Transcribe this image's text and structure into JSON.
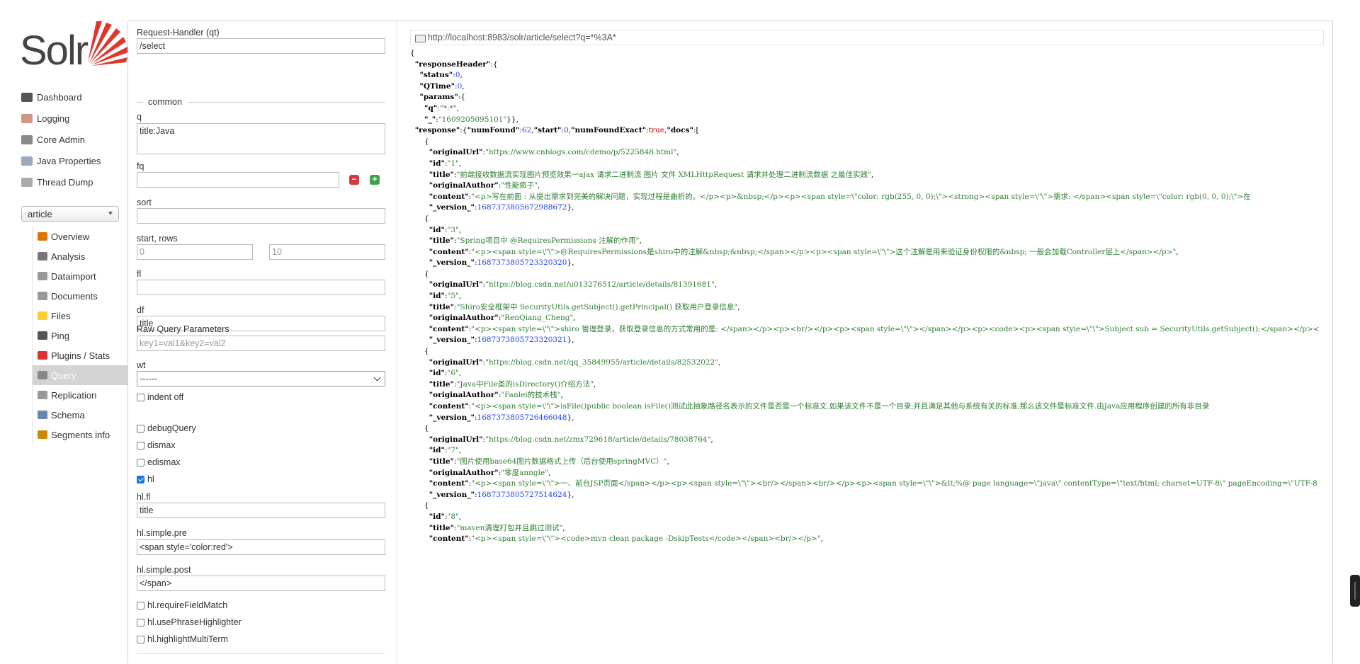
{
  "app": {
    "logo_text": "Solr"
  },
  "nav": {
    "items": [
      {
        "label": "Dashboard",
        "icon": "dashboard-icon",
        "color": "#555"
      },
      {
        "label": "Logging",
        "icon": "logging-icon",
        "color": "#c98"
      },
      {
        "label": "Core Admin",
        "icon": "core-admin-icon",
        "color": "#888"
      },
      {
        "label": "Java Properties",
        "icon": "java-properties-icon",
        "color": "#9ab"
      },
      {
        "label": "Thread Dump",
        "icon": "thread-dump-icon",
        "color": "#aaa"
      }
    ],
    "core_selected": "article",
    "core_items": [
      {
        "label": "Overview",
        "icon": "overview-icon",
        "color": "#d70"
      },
      {
        "label": "Analysis",
        "icon": "analysis-icon",
        "color": "#777"
      },
      {
        "label": "Dataimport",
        "icon": "dataimport-icon",
        "color": "#999"
      },
      {
        "label": "Documents",
        "icon": "documents-icon",
        "color": "#999"
      },
      {
        "label": "Files",
        "icon": "files-icon",
        "color": "#fc3"
      },
      {
        "label": "Ping",
        "icon": "ping-icon",
        "color": "#555"
      },
      {
        "label": "Plugins / Stats",
        "icon": "plugins-icon",
        "color": "#d33"
      },
      {
        "label": "Query",
        "icon": "query-icon",
        "color": "#888",
        "active": true
      },
      {
        "label": "Replication",
        "icon": "replication-icon",
        "color": "#999"
      },
      {
        "label": "Schema",
        "icon": "schema-icon",
        "color": "#68a"
      },
      {
        "label": "Segments info",
        "icon": "segments-icon",
        "color": "#c80"
      }
    ]
  },
  "form": {
    "qt_label": "Request-Handler (qt)",
    "qt_value": "/select",
    "common_legend": "common",
    "q_label": "q",
    "q_value": "title:Java",
    "fq_label": "fq",
    "fq_value": "",
    "fq_remove": "−",
    "fq_add": "+",
    "sort_label": "sort",
    "sort_value": "",
    "start_rows_label": "start, rows",
    "start_placeholder": "0",
    "rows_placeholder": "10",
    "fl_label": "fl",
    "fl_value": "",
    "df_label": "df",
    "df_value": "title",
    "raw_label": "Raw Query Parameters",
    "raw_placeholder": "key1=val1&key2=val2",
    "wt_label": "wt",
    "wt_value": "------",
    "indent_label": "indent off",
    "debug_label": "debugQuery",
    "dismax_label": "dismax",
    "edismax_label": "edismax",
    "hl_label": "hl",
    "hl_checked": true,
    "hlfl_label": "hl.fl",
    "hlfl_value": "title",
    "pre_label": "hl.simple.pre",
    "pre_value": "<span style='color:red'>",
    "post_label": "hl.simple.post",
    "post_value": "</span>",
    "rfm_label": "hl.requireFieldMatch",
    "uph_label": "hl.usePhraseHighlighter",
    "hmt_label": "hl.highlightMultiTerm"
  },
  "response": {
    "url": "http://localhost:8983/solr/article/select?q=*%3A*",
    "lines": [
      [
        {
          "t": "p",
          "v": "{"
        }
      ],
      [
        {
          "t": "p",
          "v": "  "
        },
        {
          "t": "k",
          "v": "\"responseHeader\""
        },
        {
          "t": "p",
          "v": ":{"
        }
      ],
      [
        {
          "t": "p",
          "v": "    "
        },
        {
          "t": "k",
          "v": "\"status\""
        },
        {
          "t": "p",
          "v": ":"
        },
        {
          "t": "n",
          "v": "0"
        },
        {
          "t": "p",
          "v": ","
        }
      ],
      [
        {
          "t": "p",
          "v": "    "
        },
        {
          "t": "k",
          "v": "\"QTime\""
        },
        {
          "t": "p",
          "v": ":"
        },
        {
          "t": "n",
          "v": "0"
        },
        {
          "t": "p",
          "v": ","
        }
      ],
      [
        {
          "t": "p",
          "v": "    "
        },
        {
          "t": "k",
          "v": "\"params\""
        },
        {
          "t": "p",
          "v": ":{"
        }
      ],
      [
        {
          "t": "p",
          "v": "      "
        },
        {
          "t": "k",
          "v": "\"q\""
        },
        {
          "t": "p",
          "v": ":"
        },
        {
          "t": "s",
          "v": "\"*:*\""
        },
        {
          "t": "p",
          "v": ","
        }
      ],
      [
        {
          "t": "p",
          "v": "      "
        },
        {
          "t": "k",
          "v": "\"_\""
        },
        {
          "t": "p",
          "v": ":"
        },
        {
          "t": "s",
          "v": "\"1609205095101\""
        },
        {
          "t": "p",
          "v": "}},"
        }
      ],
      [
        {
          "t": "p",
          "v": "  "
        },
        {
          "t": "k",
          "v": "\"response\""
        },
        {
          "t": "p",
          "v": ":{"
        },
        {
          "t": "k",
          "v": "\"numFound\""
        },
        {
          "t": "p",
          "v": ":"
        },
        {
          "t": "n",
          "v": "62"
        },
        {
          "t": "p",
          "v": ","
        },
        {
          "t": "k",
          "v": "\"start\""
        },
        {
          "t": "p",
          "v": ":"
        },
        {
          "t": "n",
          "v": "0"
        },
        {
          "t": "p",
          "v": ","
        },
        {
          "t": "k",
          "v": "\"numFoundExact\""
        },
        {
          "t": "p",
          "v": ":"
        },
        {
          "t": "b",
          "v": "true"
        },
        {
          "t": "p",
          "v": ","
        },
        {
          "t": "k",
          "v": "\"docs\""
        },
        {
          "t": "p",
          "v": ":["
        }
      ],
      [
        {
          "t": "p",
          "v": "      {"
        }
      ],
      [
        {
          "t": "p",
          "v": "        "
        },
        {
          "t": "k",
          "v": "\"originalUrl\""
        },
        {
          "t": "p",
          "v": ":"
        },
        {
          "t": "s",
          "v": "\"https://www.cnblogs.com/cdemo/p/5225848.html\""
        },
        {
          "t": "p",
          "v": ","
        }
      ],
      [
        {
          "t": "p",
          "v": "        "
        },
        {
          "t": "k",
          "v": "\"id\""
        },
        {
          "t": "p",
          "v": ":"
        },
        {
          "t": "s",
          "v": "\"1\""
        },
        {
          "t": "p",
          "v": ","
        }
      ],
      [
        {
          "t": "p",
          "v": "        "
        },
        {
          "t": "k",
          "v": "\"title\""
        },
        {
          "t": "p",
          "v": ":"
        },
        {
          "t": "s",
          "v": "\"前端接收数据流实现图片预览效果一ajax 请求二进制流 图片 文件 XMLHttpRequest 请求并处理二进制流数据 之最佳实践\""
        },
        {
          "t": "p",
          "v": ","
        }
      ],
      [
        {
          "t": "p",
          "v": "        "
        },
        {
          "t": "k",
          "v": "\"originalAuthor\""
        },
        {
          "t": "p",
          "v": ":"
        },
        {
          "t": "s",
          "v": "\"性能疯子\""
        },
        {
          "t": "p",
          "v": ","
        }
      ],
      [
        {
          "t": "p",
          "v": "        "
        },
        {
          "t": "k",
          "v": "\"content\""
        },
        {
          "t": "p",
          "v": ":"
        },
        {
          "t": "s",
          "v": "\"<p>写在前面 : 从提出需求到完美的解决问题，实现过程是曲折的。</p><p>&nbsp;</p><p><span style=\\\"color: rgb(255, 0, 0);\\\"><strong><span style=\\\"\\\">需求: </span><span style=\\\"color: rgb(0, 0, 0);\\\">在"
        }
      ],
      [
        {
          "t": "p",
          "v": "        "
        },
        {
          "t": "k",
          "v": "\"_version_\""
        },
        {
          "t": "p",
          "v": ":"
        },
        {
          "t": "n",
          "v": "1687373805672988672"
        },
        {
          "t": "p",
          "v": "},"
        }
      ],
      [
        {
          "t": "p",
          "v": "      {"
        }
      ],
      [
        {
          "t": "p",
          "v": "        "
        },
        {
          "t": "k",
          "v": "\"id\""
        },
        {
          "t": "p",
          "v": ":"
        },
        {
          "t": "s",
          "v": "\"3\""
        },
        {
          "t": "p",
          "v": ","
        }
      ],
      [
        {
          "t": "p",
          "v": "        "
        },
        {
          "t": "k",
          "v": "\"title\""
        },
        {
          "t": "p",
          "v": ":"
        },
        {
          "t": "s",
          "v": "\"Spring项目中 @RequiresPermissions 注解的作用\""
        },
        {
          "t": "p",
          "v": ","
        }
      ],
      [
        {
          "t": "p",
          "v": "        "
        },
        {
          "t": "k",
          "v": "\"content\""
        },
        {
          "t": "p",
          "v": ":"
        },
        {
          "t": "s",
          "v": "\"<p><span style=\\\"\\\">@RequiresPermissions是shiro中的注解&nbsp;&nbsp;</span></p><p><span style=\\\"\\\">这个注解是用来验证身份权限的&nbsp; 一般会加载Controller层上</span></p>\""
        },
        {
          "t": "p",
          "v": ","
        }
      ],
      [
        {
          "t": "p",
          "v": "        "
        },
        {
          "t": "k",
          "v": "\"_version_\""
        },
        {
          "t": "p",
          "v": ":"
        },
        {
          "t": "n",
          "v": "1687373805723320320"
        },
        {
          "t": "p",
          "v": "},"
        }
      ],
      [
        {
          "t": "p",
          "v": "      {"
        }
      ],
      [
        {
          "t": "p",
          "v": "        "
        },
        {
          "t": "k",
          "v": "\"originalUrl\""
        },
        {
          "t": "p",
          "v": ":"
        },
        {
          "t": "s",
          "v": "\"https://blog.csdn.net/u013276512/article/details/81391681\""
        },
        {
          "t": "p",
          "v": ","
        }
      ],
      [
        {
          "t": "p",
          "v": "        "
        },
        {
          "t": "k",
          "v": "\"id\""
        },
        {
          "t": "p",
          "v": ":"
        },
        {
          "t": "s",
          "v": "\"5\""
        },
        {
          "t": "p",
          "v": ","
        }
      ],
      [
        {
          "t": "p",
          "v": "        "
        },
        {
          "t": "k",
          "v": "\"title\""
        },
        {
          "t": "p",
          "v": ":"
        },
        {
          "t": "s",
          "v": "\"Shiro安全框架中 SecurityUtils.getSubject().getPrincipal() 获取用户登录信息\""
        },
        {
          "t": "p",
          "v": ","
        }
      ],
      [
        {
          "t": "p",
          "v": "        "
        },
        {
          "t": "k",
          "v": "\"originalAuthor\""
        },
        {
          "t": "p",
          "v": ":"
        },
        {
          "t": "s",
          "v": "\"RenQiang_Cheng\""
        },
        {
          "t": "p",
          "v": ","
        }
      ],
      [
        {
          "t": "p",
          "v": "        "
        },
        {
          "t": "k",
          "v": "\"content\""
        },
        {
          "t": "p",
          "v": ":"
        },
        {
          "t": "s",
          "v": "\"<p><span style=\\\"\\\">shiro 管理登录，获取登录信息的方式常用的是: </span></p><p><br/></p><p><span style=\\\"\\\"></span></p><p><code><p><span style=\\\"\\\">Subject sub = SecurityUtils.getSubject();</span></p><"
        }
      ],
      [
        {
          "t": "p",
          "v": "        "
        },
        {
          "t": "k",
          "v": "\"_version_\""
        },
        {
          "t": "p",
          "v": ":"
        },
        {
          "t": "n",
          "v": "1687373805723320321"
        },
        {
          "t": "p",
          "v": "},"
        }
      ],
      [
        {
          "t": "p",
          "v": "      {"
        }
      ],
      [
        {
          "t": "p",
          "v": "        "
        },
        {
          "t": "k",
          "v": "\"originalUrl\""
        },
        {
          "t": "p",
          "v": ":"
        },
        {
          "t": "s",
          "v": "\"https://blog.csdn.net/qq_35849955/article/details/82532022\""
        },
        {
          "t": "p",
          "v": ","
        }
      ],
      [
        {
          "t": "p",
          "v": "        "
        },
        {
          "t": "k",
          "v": "\"id\""
        },
        {
          "t": "p",
          "v": ":"
        },
        {
          "t": "s",
          "v": "\"6\""
        },
        {
          "t": "p",
          "v": ","
        }
      ],
      [
        {
          "t": "p",
          "v": "        "
        },
        {
          "t": "k",
          "v": "\"title\""
        },
        {
          "t": "p",
          "v": ":"
        },
        {
          "t": "s",
          "v": "\"Java中File类的isDirectory()介绍方法\""
        },
        {
          "t": "p",
          "v": ","
        }
      ],
      [
        {
          "t": "p",
          "v": "        "
        },
        {
          "t": "k",
          "v": "\"originalAuthor\""
        },
        {
          "t": "p",
          "v": ":"
        },
        {
          "t": "s",
          "v": "\"Fanlei的技术栈\""
        },
        {
          "t": "p",
          "v": ","
        }
      ],
      [
        {
          "t": "p",
          "v": "        "
        },
        {
          "t": "k",
          "v": "\"content\""
        },
        {
          "t": "p",
          "v": ":"
        },
        {
          "t": "s",
          "v": "\"<p><span style=\\\"\\\">isFile()public boolean isFile()测试此抽象路径名表示的文件是否是一个标准文.如果该文件不是一个目录,并且满足其他与系统有关的标准,那么该文件是标准文件.由Java应用程序创建的所有非目录"
        }
      ],
      [
        {
          "t": "p",
          "v": "        "
        },
        {
          "t": "k",
          "v": "\"_version_\""
        },
        {
          "t": "p",
          "v": ":"
        },
        {
          "t": "n",
          "v": "1687373805726466048"
        },
        {
          "t": "p",
          "v": "},"
        }
      ],
      [
        {
          "t": "p",
          "v": "      {"
        }
      ],
      [
        {
          "t": "p",
          "v": "        "
        },
        {
          "t": "k",
          "v": "\"originalUrl\""
        },
        {
          "t": "p",
          "v": ":"
        },
        {
          "t": "s",
          "v": "\"https://blog.csdn.net/zmx729618/article/details/78038764\""
        },
        {
          "t": "p",
          "v": ","
        }
      ],
      [
        {
          "t": "p",
          "v": "        "
        },
        {
          "t": "k",
          "v": "\"id\""
        },
        {
          "t": "p",
          "v": ":"
        },
        {
          "t": "s",
          "v": "\"7\""
        },
        {
          "t": "p",
          "v": ","
        }
      ],
      [
        {
          "t": "p",
          "v": "        "
        },
        {
          "t": "k",
          "v": "\"title\""
        },
        {
          "t": "p",
          "v": ":"
        },
        {
          "t": "s",
          "v": "\"图片使用base64图片数据格式上传（后台使用springMVC）\""
        },
        {
          "t": "p",
          "v": ","
        }
      ],
      [
        {
          "t": "p",
          "v": "        "
        },
        {
          "t": "k",
          "v": "\"originalAuthor\""
        },
        {
          "t": "p",
          "v": ":"
        },
        {
          "t": "s",
          "v": "\"零度anngle\""
        },
        {
          "t": "p",
          "v": ","
        }
      ],
      [
        {
          "t": "p",
          "v": "        "
        },
        {
          "t": "k",
          "v": "\"content\""
        },
        {
          "t": "p",
          "v": ":"
        },
        {
          "t": "s",
          "v": "\"<p><span style=\\\"\\\">一、前台JSP页面</span></p><p><span style=\\\"\\\"><br/></span><br/></p><p><span style=\\\"\\\">&lt;%@ page language=\\\"java\\\" contentType=\\\"text/html; charset=UTF-8\\\" pageEncoding=\\\"UTF-8"
        }
      ],
      [
        {
          "t": "p",
          "v": "        "
        },
        {
          "t": "k",
          "v": "\"_version_\""
        },
        {
          "t": "p",
          "v": ":"
        },
        {
          "t": "n",
          "v": "1687373805727514624"
        },
        {
          "t": "p",
          "v": "},"
        }
      ],
      [
        {
          "t": "p",
          "v": "      {"
        }
      ],
      [
        {
          "t": "p",
          "v": "        "
        },
        {
          "t": "k",
          "v": "\"id\""
        },
        {
          "t": "p",
          "v": ":"
        },
        {
          "t": "s",
          "v": "\"8\""
        },
        {
          "t": "p",
          "v": ","
        }
      ],
      [
        {
          "t": "p",
          "v": "        "
        },
        {
          "t": "k",
          "v": "\"title\""
        },
        {
          "t": "p",
          "v": ":"
        },
        {
          "t": "s",
          "v": "\"maven清理打包并且跳过测试\""
        },
        {
          "t": "p",
          "v": ","
        }
      ],
      [
        {
          "t": "p",
          "v": "        "
        },
        {
          "t": "k",
          "v": "\"content\""
        },
        {
          "t": "p",
          "v": ":"
        },
        {
          "t": "s",
          "v": "\"<p><span style=\\\"\\\"><code>mvn clean package -DskipTests</code></span><br/></p>\""
        },
        {
          "t": "p",
          "v": ","
        }
      ]
    ]
  }
}
